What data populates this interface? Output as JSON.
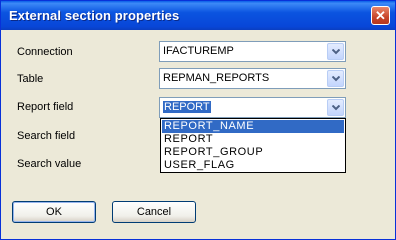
{
  "window": {
    "title": "External section properties",
    "close_glyph": "✕"
  },
  "form": {
    "connection": {
      "label": "Connection",
      "value": "IFACTUREMP"
    },
    "table": {
      "label": "Table",
      "value": "REPMAN_REPORTS"
    },
    "report_field": {
      "label": "Report field",
      "value": "REPORT",
      "options": [
        "REPORT_NAME",
        "REPORT",
        "REPORT_GROUP",
        "USER_FLAG"
      ],
      "highlighted_option": "REPORT_NAME"
    },
    "search_field": {
      "label": "Search field"
    },
    "search_value": {
      "label": "Search value"
    }
  },
  "buttons": {
    "ok": "OK",
    "cancel": "Cancel"
  },
  "colors": {
    "titlebar": "#0b54e0",
    "selection": "#316ac5",
    "dialog_bg": "#ece9d8"
  },
  "icons": {
    "close": "close-icon",
    "dropdown": "chevron-down-icon"
  }
}
